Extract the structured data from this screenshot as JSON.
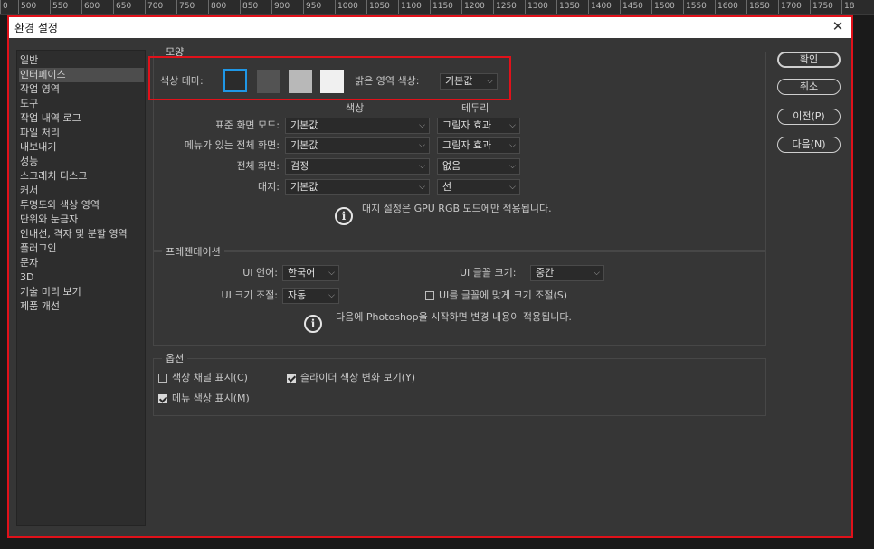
{
  "ruler": {
    "ticks": [
      "0",
      "500",
      "550",
      "600",
      "650",
      "700",
      "750",
      "800",
      "850",
      "900",
      "950",
      "1000",
      "1050",
      "1100",
      "1150",
      "1200",
      "1250",
      "1300",
      "1350",
      "1400",
      "1450",
      "1500",
      "1550",
      "1600",
      "1650",
      "1700",
      "1750",
      "18"
    ]
  },
  "dialog": {
    "title": "환경 설정",
    "close_glyph": "✕"
  },
  "sidebar": {
    "items": [
      {
        "label": "일반"
      },
      {
        "label": "인터페이스",
        "selected": true
      },
      {
        "label": "작업 영역"
      },
      {
        "label": "도구"
      },
      {
        "label": "작업 내역 로그"
      },
      {
        "label": "파일 처리"
      },
      {
        "label": "내보내기"
      },
      {
        "label": "성능"
      },
      {
        "label": "스크래치 디스크"
      },
      {
        "label": "커서"
      },
      {
        "label": "투명도와 색상 영역"
      },
      {
        "label": "단위와 눈금자"
      },
      {
        "label": "안내선, 격자 및 분할 영역"
      },
      {
        "label": "플러그인"
      },
      {
        "label": "문자"
      },
      {
        "label": "3D"
      },
      {
        "label": "기술 미리 보기"
      },
      {
        "label": "제품 개선"
      }
    ]
  },
  "appearance": {
    "title": "모양",
    "color_theme_label": "색상 테마:",
    "theme_swatches": [
      {
        "color": "#2b2b2b",
        "selected": true
      },
      {
        "color": "#535353"
      },
      {
        "color": "#b8b8b8"
      },
      {
        "color": "#f0f0f0"
      }
    ],
    "highlight_label": "밝은 영역 색상:",
    "highlight_value": "기본값",
    "col_color": "색상",
    "col_border": "테두리",
    "rows": [
      {
        "label": "표준 화면 모드:",
        "color": "기본값",
        "border": "그림자 효과"
      },
      {
        "label": "메뉴가 있는 전체 화면:",
        "color": "기본값",
        "border": "그림자 효과"
      },
      {
        "label": "전체 화면:",
        "color": "검정",
        "border": "없음"
      },
      {
        "label": "대지:",
        "color": "기본값",
        "border": "선"
      }
    ],
    "note": "대지 설정은 GPU RGB 모드에만 적용됩니다."
  },
  "presentation": {
    "title": "프레젠테이션",
    "ui_language_label": "UI 언어:",
    "ui_language_value": "한국어",
    "ui_font_size_label": "UI 글꼴 크기:",
    "ui_font_size_value": "중간",
    "ui_scale_label": "UI 크기 조절:",
    "ui_scale_value": "자동",
    "scale_to_font_label": "UI를 글꼴에 맞게 크기 조절(S)",
    "scale_to_font_checked": false,
    "note": "다음에 Photoshop을 시작하면 변경 내용이 적용됩니다."
  },
  "options": {
    "title": "옵션",
    "show_channels_label": "색상 채널 표시(C)",
    "show_channels_checked": false,
    "slider_color_label": "슬라이더 색상 변화 보기(Y)",
    "slider_color_checked": true,
    "menu_color_label": "메뉴 색상 표시(M)",
    "menu_color_checked": true
  },
  "buttons": {
    "ok": "확인",
    "cancel": "취소",
    "prev": "이전(P)",
    "next": "다음(N)"
  },
  "colors": {
    "highlight_border": "#e0111a",
    "dialog_bg": "#363636",
    "sidebar_bg": "#2d2d2d",
    "selected_item_bg": "#4d4d4d"
  }
}
